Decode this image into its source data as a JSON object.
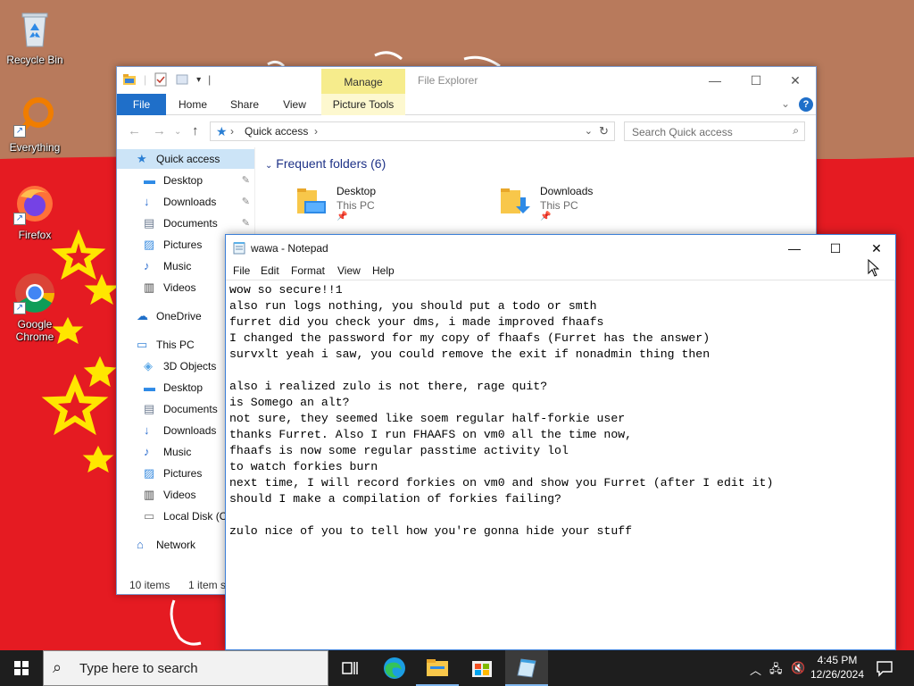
{
  "desktop": {
    "icons": [
      {
        "label": "Recycle Bin",
        "icon": "recycle-bin-icon"
      },
      {
        "label": "Everything",
        "icon": "everything-search-icon"
      },
      {
        "label": "Firefox",
        "icon": "firefox-icon"
      },
      {
        "label": "Google Chrome",
        "icon": "chrome-icon"
      }
    ]
  },
  "explorer": {
    "title": "File Explorer",
    "manage_tab": "Manage",
    "ribbon_tabs": [
      "File",
      "Home",
      "Share",
      "View",
      "Picture Tools"
    ],
    "address": "Quick access",
    "search_placeholder": "Search Quick access",
    "nav_items": [
      {
        "label": "Quick access",
        "icon": "quick-access-star-icon",
        "pinned": false,
        "selected": true
      },
      {
        "label": "Desktop",
        "icon": "desktop-icon",
        "pinned": true
      },
      {
        "label": "Downloads",
        "icon": "downloads-icon",
        "pinned": true
      },
      {
        "label": "Documents",
        "icon": "documents-icon",
        "pinned": true
      },
      {
        "label": "Pictures",
        "icon": "pictures-icon",
        "pinned": false
      },
      {
        "label": "Music",
        "icon": "music-icon",
        "pinned": false
      },
      {
        "label": "Videos",
        "icon": "videos-icon",
        "pinned": false
      },
      {
        "label": "OneDrive",
        "icon": "onedrive-icon",
        "pinned": false
      },
      {
        "label": "This PC",
        "icon": "this-pc-icon",
        "pinned": false
      },
      {
        "label": "3D Objects",
        "icon": "3d-objects-icon",
        "pinned": false
      },
      {
        "label": "Desktop",
        "icon": "desktop-icon",
        "pinned": false
      },
      {
        "label": "Documents",
        "icon": "documents-icon",
        "pinned": false
      },
      {
        "label": "Downloads",
        "icon": "downloads-icon",
        "pinned": false
      },
      {
        "label": "Music",
        "icon": "music-icon",
        "pinned": false
      },
      {
        "label": "Pictures",
        "icon": "pictures-icon",
        "pinned": false
      },
      {
        "label": "Videos",
        "icon": "videos-icon",
        "pinned": false
      },
      {
        "label": "Local Disk (C",
        "icon": "local-disk-icon",
        "pinned": false
      },
      {
        "label": "Network",
        "icon": "network-icon",
        "pinned": false
      }
    ],
    "frequent_header": "Frequent folders (6)",
    "tiles": [
      {
        "name": "Desktop",
        "location": "This PC"
      },
      {
        "name": "Downloads",
        "location": "This PC"
      }
    ],
    "status": {
      "items": "10 items",
      "selected": "1 item s"
    }
  },
  "notepad": {
    "title": "wawa - Notepad",
    "menu": [
      "File",
      "Edit",
      "Format",
      "View",
      "Help"
    ],
    "lines": [
      "wow so secure!!1",
      "also run logs nothing, you should put a todo or smth",
      "furret did you check your dms, i made improved fhaafs",
      "I changed the password for my copy of fhaafs (Furret has the answer)",
      "survxlt yeah i saw, you could remove the exit if nonadmin thing then",
      "",
      "also i realized zulo is not there, rage quit?",
      "is Somego an alt?",
      "not sure, they seemed like soem regular half-forkie user",
      "thanks Furret. Also I run FHAAFS on vm0 all the time now,",
      "fhaafs is now some regular passtime activity lol",
      "to watch forkies burn",
      "next time, I will record forkies on vm0 and show you Furret (after I edit it)",
      "should I make a compilation of forkies failing?",
      "",
      "zulo nice of you to tell how you're gonna hide your stuff"
    ]
  },
  "taskbar": {
    "search_placeholder": "Type here to search",
    "apps": [
      "task-view-icon",
      "edge-icon",
      "file-explorer-icon",
      "store-icon",
      "notepad-icon"
    ],
    "time": "4:45 PM",
    "date": "12/26/2024"
  },
  "colors": {
    "wallpaper_red": "#e51b22",
    "wallpaper_brown": "#b87a5c",
    "accent_blue": "#1f6fc9",
    "manage_yellow": "#f6ec8c",
    "taskbar": "#1e1e1e"
  }
}
